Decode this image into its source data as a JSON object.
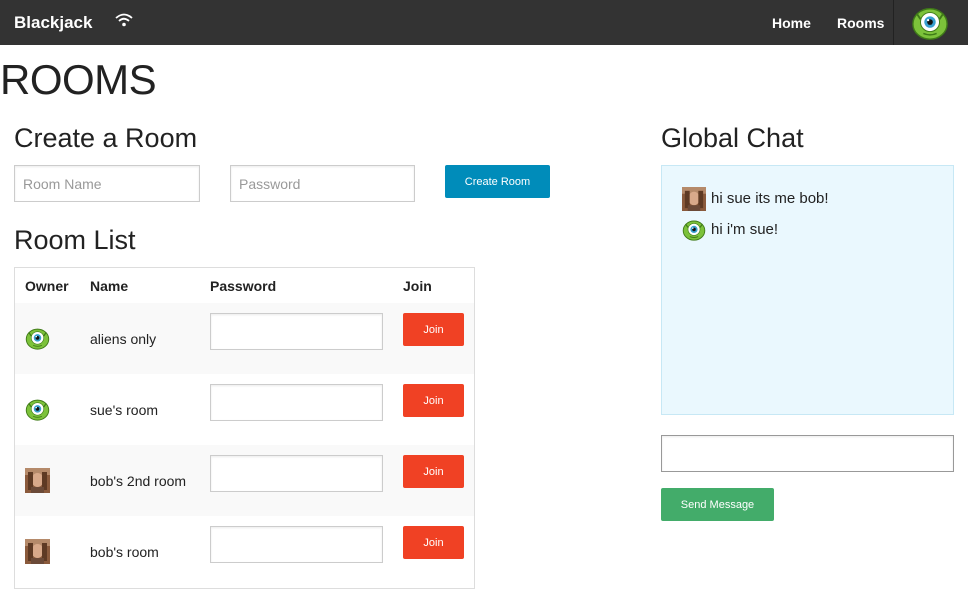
{
  "navbar": {
    "brand": "Blackjack",
    "status_icon": "wifi-icon",
    "links": {
      "home": "Home",
      "rooms": "Rooms"
    },
    "user_avatar": "alien-avatar"
  },
  "page": {
    "title": "ROOMS"
  },
  "create_room": {
    "title": "Create a Room",
    "room_name_placeholder": "Room Name",
    "password_placeholder": "Password",
    "button_label": "Create Room"
  },
  "room_list": {
    "title": "Room List",
    "headers": {
      "owner": "Owner",
      "name": "Name",
      "password": "Password",
      "join": "Join"
    },
    "rooms": [
      {
        "owner": "alien-avatar",
        "name": "aliens only",
        "join_label": "Join"
      },
      {
        "owner": "alien-avatar",
        "name": "sue's room",
        "join_label": "Join"
      },
      {
        "owner": "photo-avatar",
        "name": "bob's 2nd room",
        "join_label": "Join"
      },
      {
        "owner": "photo-avatar",
        "name": "bob's room",
        "join_label": "Join"
      }
    ]
  },
  "chat": {
    "title": "Global Chat",
    "messages": [
      {
        "avatar": "photo-avatar",
        "text": "hi sue its me bob!"
      },
      {
        "avatar": "alien-avatar",
        "text": "hi i'm sue!"
      }
    ],
    "input_value": "",
    "send_label": "Send Message"
  },
  "colors": {
    "navbar": "#333333",
    "create_button": "#008cba",
    "join_button": "#f04124",
    "send_button": "#43ac6a",
    "chat_background": "#eaf8fe"
  }
}
